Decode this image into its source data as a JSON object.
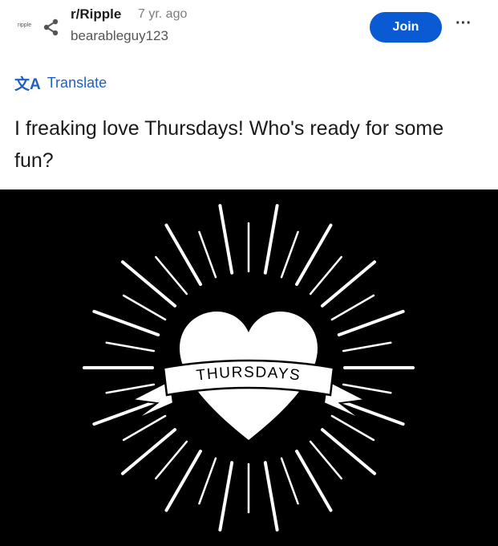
{
  "post": {
    "subreddit_logo_text": "ripple",
    "subreddit": "r/Ripple",
    "time": "7 yr. ago",
    "author": "bearableguy123",
    "join_label": "Join",
    "more_label": "···",
    "translate_icon": "文A",
    "translate_label": "Translate",
    "title": "I freaking love Thursdays! Who's ready for some fun?"
  },
  "image": {
    "banner_text": "THURSDAYS",
    "icon": "heart-with-rays"
  },
  "colors": {
    "join_button": "#0a5bd3",
    "translate": "#1f5fc4",
    "image_background": "#000000"
  }
}
